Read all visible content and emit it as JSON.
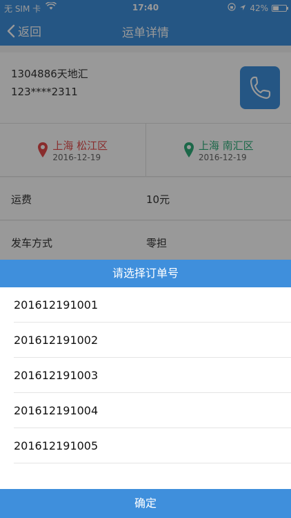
{
  "status_bar": {
    "carrier": "无 SIM 卡",
    "time": "17:40",
    "battery": "42%",
    "battery_level": 0.42
  },
  "nav": {
    "back_label": "返回",
    "title": "运单详情"
  },
  "contact": {
    "name": "1304886天地汇",
    "phone": "123****2311"
  },
  "route": {
    "from": {
      "city": "上海 松江区",
      "date": "2016-12-19"
    },
    "to": {
      "city": "上海 南汇区",
      "date": "2016-12-19"
    }
  },
  "details": [
    {
      "label": "运费",
      "value": "10元"
    },
    {
      "label": "发车方式",
      "value": "零担"
    }
  ],
  "picker": {
    "title": "请选择订单号",
    "options": [
      "201612191001",
      "201612191002",
      "201612191003",
      "201612191004",
      "201612191005"
    ],
    "confirm_label": "确定"
  },
  "colors": {
    "primary": "#3f8fdc",
    "origin": "#e44c4c",
    "destination": "#2fae7a"
  }
}
